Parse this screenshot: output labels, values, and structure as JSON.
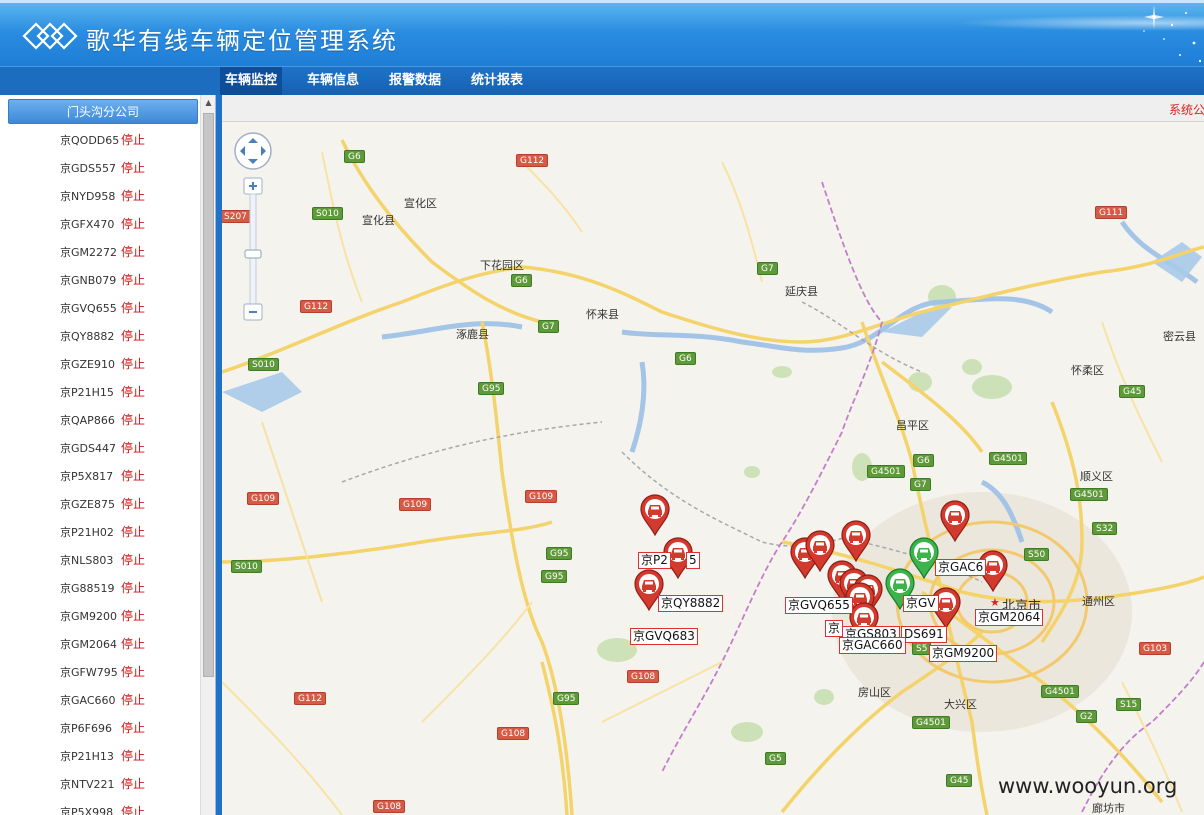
{
  "app": {
    "title": "歌华有线车辆定位管理系统"
  },
  "nav": {
    "items": [
      {
        "label": "车辆监控",
        "active": true
      },
      {
        "label": "车辆信息",
        "active": false
      },
      {
        "label": "报警数据",
        "active": false
      },
      {
        "label": "统计报表",
        "active": false
      }
    ]
  },
  "ticker": {
    "text": "系统公"
  },
  "sidebar": {
    "group": "门头沟分公司",
    "vehicles": [
      {
        "plate": "京QODD65",
        "status": "停止"
      },
      {
        "plate": "京GDS557",
        "status": "停止"
      },
      {
        "plate": "京NYD958",
        "status": "停止"
      },
      {
        "plate": "京GFX470",
        "status": "停止"
      },
      {
        "plate": "京GM2272",
        "status": "停止"
      },
      {
        "plate": "京GNB079",
        "status": "停止"
      },
      {
        "plate": "京GVQ655",
        "status": "停止"
      },
      {
        "plate": "京QY8882",
        "status": "停止"
      },
      {
        "plate": "京GZE910",
        "status": "停止"
      },
      {
        "plate": "京P21H15",
        "status": "停止"
      },
      {
        "plate": "京QAP866",
        "status": "停止"
      },
      {
        "plate": "京GDS447",
        "status": "停止"
      },
      {
        "plate": "京P5X817",
        "status": "停止"
      },
      {
        "plate": "京GZE875",
        "status": "停止"
      },
      {
        "plate": "京P21H02",
        "status": "停止"
      },
      {
        "plate": "京NLS803",
        "status": "停止"
      },
      {
        "plate": "京G88519",
        "status": "停止"
      },
      {
        "plate": "京GM9200",
        "status": "停止"
      },
      {
        "plate": "京GM2064",
        "status": "停止"
      },
      {
        "plate": "京GFW795",
        "status": "停止"
      },
      {
        "plate": "京GAC660",
        "status": "停止"
      },
      {
        "plate": "京P6F696",
        "status": "停止"
      },
      {
        "plate": "京P21H13",
        "status": "停止"
      },
      {
        "plate": "京NTV221",
        "status": "停止"
      },
      {
        "plate": "京P5X998",
        "status": "停止"
      }
    ]
  },
  "map": {
    "places": [
      "宣化区",
      "宣化县",
      "下花园区",
      "怀来县",
      "延庆县",
      "涿鹿县",
      "昌平区",
      "怀柔区",
      "密云县",
      "顺义区",
      "北京市",
      "通州区",
      "房山区",
      "大兴区",
      "廊坊市"
    ],
    "roads": [
      "G6",
      "G112",
      "S010",
      "G7",
      "G6",
      "G111",
      "G7",
      "G112",
      "S010",
      "G95",
      "G6",
      "G4501",
      "G6",
      "G4501",
      "G45",
      "G7",
      "G109",
      "G109",
      "G109",
      "G95",
      "G95",
      "S010",
      "G4501",
      "S32",
      "S50",
      "G103",
      "G112",
      "G108",
      "G95",
      "G108",
      "G4501",
      "G2",
      "S15",
      "G5",
      "G45",
      "G108",
      "S207",
      "G4501",
      "S5"
    ],
    "vehicle_labels": [
      "京P2",
      "5",
      "京QY8882",
      "京GVQ683",
      "京GVQ655",
      "京GAC6",
      "京GV",
      "京GM2064",
      "京GS803",
      "DS691",
      "京GAC660",
      "京GM9200",
      "京"
    ],
    "north_capital_star": "★"
  },
  "watermark": "www.wooyun.org"
}
